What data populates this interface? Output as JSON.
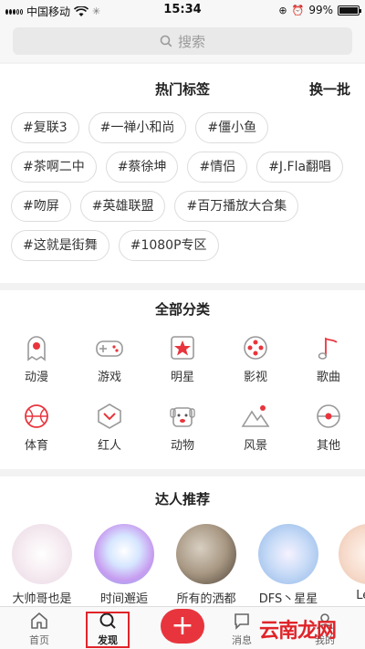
{
  "status_bar": {
    "carrier": "中国移动",
    "time": "15:34",
    "battery": "99%",
    "battery_level": 0.99
  },
  "search": {
    "placeholder": "搜索"
  },
  "hot_tags": {
    "title": "热门标签",
    "refresh_label": "换一批",
    "rows": [
      [
        "#复联3",
        "#一禅小和尚",
        "#僵小鱼"
      ],
      [
        "#茶啊二中",
        "#蔡徐坤",
        "#情侣",
        "#J.Fla翻唱"
      ],
      [
        "#吻屏",
        "#英雄联盟",
        "#百万播放大合集"
      ],
      [
        "#这就是街舞",
        "#1080P专区"
      ]
    ]
  },
  "categories": {
    "title": "全部分类",
    "items": [
      {
        "label": "动漫",
        "icon": "ghost-icon"
      },
      {
        "label": "游戏",
        "icon": "gamepad-icon"
      },
      {
        "label": "明星",
        "icon": "star-icon"
      },
      {
        "label": "影视",
        "icon": "film-reel-icon"
      },
      {
        "label": "歌曲",
        "icon": "music-note-icon"
      },
      {
        "label": "体育",
        "icon": "basketball-icon"
      },
      {
        "label": "红人",
        "icon": "chevron-badge-icon"
      },
      {
        "label": "动物",
        "icon": "dog-face-icon"
      },
      {
        "label": "风景",
        "icon": "mountain-icon"
      },
      {
        "label": "其他",
        "icon": "more-circle-icon"
      }
    ],
    "accent_color": "#e8353d"
  },
  "experts": {
    "title": "达人推荐",
    "items": [
      {
        "name": "大帅哥也是"
      },
      {
        "name": "时间邂逅"
      },
      {
        "name": "所有的洒都"
      },
      {
        "name": "DFS丶星星"
      },
      {
        "name": "Le..."
      }
    ]
  },
  "tabbar": {
    "items": [
      {
        "label": "首页",
        "icon": "home-icon"
      },
      {
        "label": "发现",
        "icon": "search-icon"
      },
      {
        "label": "",
        "icon": "plus-icon"
      },
      {
        "label": "消息",
        "icon": "message-icon"
      },
      {
        "label": "我的",
        "icon": "user-icon"
      }
    ],
    "active_color": "#e8353d"
  },
  "watermark": "云南龙网"
}
